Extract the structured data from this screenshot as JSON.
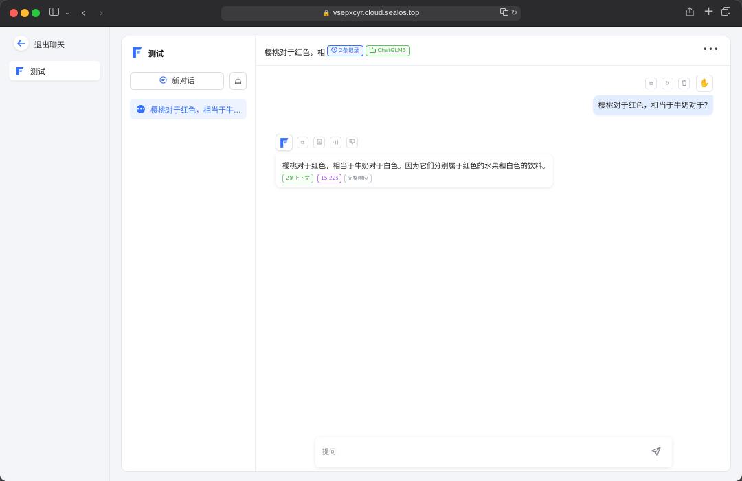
{
  "browser": {
    "url": "vsepxcyr.cloud.sealos.top"
  },
  "sidebar": {
    "back_label": "退出聊天",
    "items": [
      {
        "label": "测试"
      }
    ]
  },
  "history": {
    "app_name": "测试",
    "new_chat_label": "新对话",
    "items": [
      {
        "label": "樱桃对于红色，相当于牛..."
      }
    ]
  },
  "chat": {
    "title": "樱桃对于红色，相",
    "record_tag": "2条记录",
    "model_tag": "ChatGLM3",
    "user_message": "樱桃对于红色，相当于牛奶对于?",
    "bot_message": "樱桃对于红色，相当于牛奶对于白色。因为它们分别属于红色的水果和白色的饮料。",
    "bot_tags": {
      "context": "2条上下文",
      "time": "15.22s",
      "full_response": "完整响应"
    },
    "input_placeholder": "提问"
  },
  "colors": {
    "accent": "#3370ff",
    "user_bubble": "#e2edff",
    "model_tag": "#4bab4b",
    "time_tag": "#9b4fdc"
  },
  "icons": {
    "back": "arrow-left-icon",
    "new_chat": "chat-bubble-icon",
    "clear": "broom-icon",
    "history_item": "chat-bubble-icon",
    "record": "clock-icon",
    "model": "robot-icon",
    "more": "more-dots-icon",
    "send": "send-icon"
  }
}
